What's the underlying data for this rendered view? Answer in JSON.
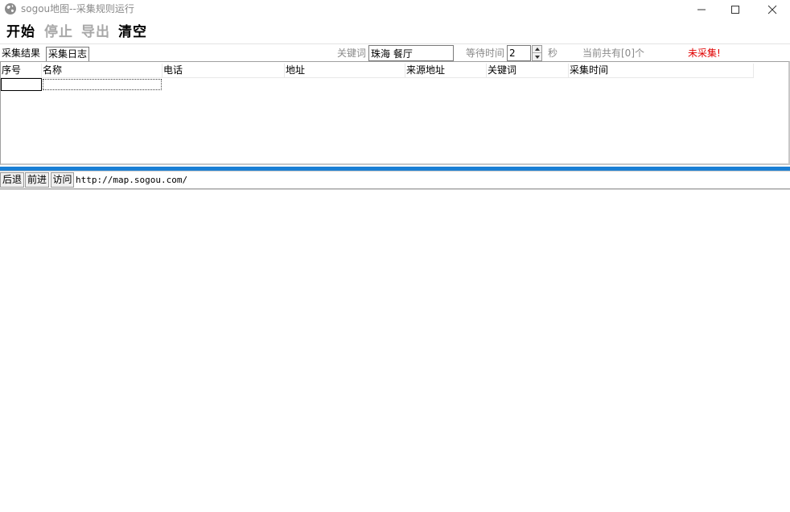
{
  "window": {
    "title": "sogou地图--采集规则运行",
    "icon": "globe-icon",
    "controls": [
      "minimize-icon",
      "maximize-icon",
      "close-icon"
    ]
  },
  "toolbar": {
    "start_label": "开始",
    "stop_label": "停止",
    "export_label": "导出",
    "clear_label": "清空"
  },
  "tabs": {
    "results_label": "采集结果",
    "log_label": "采集日志"
  },
  "params": {
    "keyword_label": "关键词",
    "keyword_value": "珠海 餐厅",
    "wait_label": "等待时间",
    "wait_value": "2",
    "seconds_label": "秒",
    "count_label": "当前共有[0]个",
    "status_label": "未采集!",
    "status_color": "#e00000"
  },
  "grid": {
    "columns": [
      "序号",
      "名称",
      "电话",
      "地址",
      "来源地址",
      "关键词",
      "采集时间"
    ]
  },
  "nav": {
    "back_label": "后退",
    "forward_label": "前进",
    "go_label": "访问",
    "url": "http://map.sogou.com/",
    "accent_color": "#1a7fd4"
  }
}
